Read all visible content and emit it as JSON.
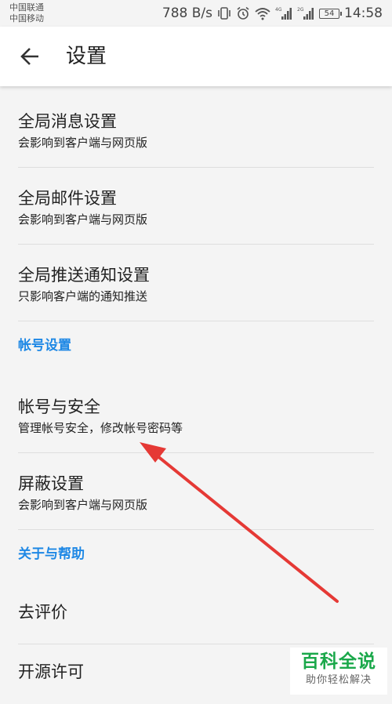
{
  "status_bar": {
    "carrier_1": "中国联通",
    "carrier_2": "中国移动",
    "speed": "788 B/s",
    "battery": "54",
    "time": "14:58",
    "signal_1_label": "4G",
    "signal_2_label": "2G"
  },
  "header": {
    "title": "设置",
    "back_icon": "arrow-left-icon"
  },
  "settings": {
    "global_message": {
      "title": "全局消息设置",
      "subtitle": "会影响到客户端与网页版"
    },
    "global_mail": {
      "title": "全局邮件设置",
      "subtitle": "会影响到客户端与网页版"
    },
    "global_push": {
      "title": "全局推送通知设置",
      "subtitle": "只影响客户端的通知推送"
    },
    "account_section": "帐号设置",
    "account_security": {
      "title": "帐号与安全",
      "subtitle": "管理帐号安全，修改帐号密码等"
    },
    "block": {
      "title": "屏蔽设置",
      "subtitle": "会影响到客户端与网页版"
    },
    "about_section": "关于与帮助",
    "rate": {
      "title": "去评价"
    },
    "open_source": {
      "title": "开源许可"
    }
  },
  "watermark": {
    "main": "百科全说",
    "sub": "助你轻松解决"
  },
  "colors": {
    "accent": "#1e88e5",
    "annotation_arrow": "#e53935",
    "watermark_green": "#1aa84a"
  }
}
